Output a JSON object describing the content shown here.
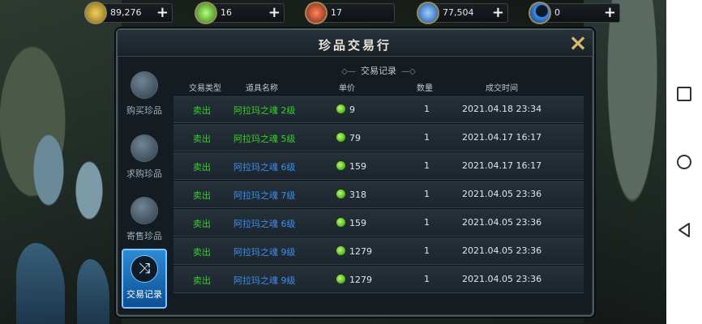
{
  "resources": [
    {
      "icon": "gold-coin-icon",
      "value": "89,276",
      "color": "#d9b13a"
    },
    {
      "icon": "green-gem-icon",
      "value": "16",
      "color": "#4fd82b"
    },
    {
      "icon": "red-gem-icon",
      "value": "17",
      "color": "#d44a2a"
    },
    {
      "icon": "blue-crystal-icon",
      "value": "77,504",
      "color": "#3b8fe8"
    },
    {
      "icon": "crescent-moon-icon",
      "value": "0",
      "color": "#2f7fe0"
    }
  ],
  "panel": {
    "title": "珍品交易行",
    "subtitle": "交易记录"
  },
  "tabs": [
    {
      "label": "购买珍品",
      "icon": "bag-icon",
      "active": false
    },
    {
      "label": "求购珍品",
      "icon": "hand-request-icon",
      "active": false
    },
    {
      "label": "寄售珍品",
      "icon": "consign-bag-icon",
      "active": false
    },
    {
      "label": "交易记录",
      "icon": "shuffle-icon",
      "active": true
    }
  ],
  "columns": [
    "交易类型",
    "道具名称",
    "单价",
    "数量",
    "成交时间"
  ],
  "records": [
    {
      "type": "卖出",
      "item": "阿拉玛之魂 2级",
      "item_color": "green",
      "price": "9",
      "qty": "1",
      "time": "2021.04.18 23:34"
    },
    {
      "type": "卖出",
      "item": "阿拉玛之魂 5级",
      "item_color": "green",
      "price": "79",
      "qty": "1",
      "time": "2021.04.17 16:17"
    },
    {
      "type": "卖出",
      "item": "阿拉玛之魂 6级",
      "item_color": "blue",
      "price": "159",
      "qty": "1",
      "time": "2021.04.17 16:17"
    },
    {
      "type": "卖出",
      "item": "阿拉玛之魂 7级",
      "item_color": "blue",
      "price": "318",
      "qty": "1",
      "time": "2021.04.05 23:36"
    },
    {
      "type": "卖出",
      "item": "阿拉玛之魂 6级",
      "item_color": "blue",
      "price": "159",
      "qty": "1",
      "time": "2021.04.05 23:36"
    },
    {
      "type": "卖出",
      "item": "阿拉玛之魂 9级",
      "item_color": "blue",
      "price": "1279",
      "qty": "1",
      "time": "2021.04.05 23:36"
    },
    {
      "type": "卖出",
      "item": "阿拉玛之魂 9级",
      "item_color": "blue",
      "price": "1279",
      "qty": "1",
      "time": "2021.04.05 23:36"
    }
  ],
  "colors": {
    "sell": "#38d02a",
    "item_green": "#38d02a",
    "item_blue": "#3c8ff0",
    "active_tab": "#2b8bd6",
    "close": "#d8b86a"
  }
}
